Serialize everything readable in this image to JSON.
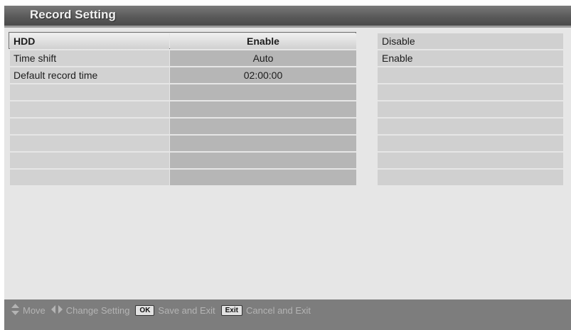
{
  "window": {
    "title": "Record Setting"
  },
  "settings": [
    {
      "label": "HDD",
      "value": "Enable"
    },
    {
      "label": "Time shift",
      "value": "Auto"
    },
    {
      "label": "Default record time",
      "value": "02:00:00"
    },
    {
      "label": "",
      "value": ""
    },
    {
      "label": "",
      "value": ""
    },
    {
      "label": "",
      "value": ""
    },
    {
      "label": "",
      "value": ""
    },
    {
      "label": "",
      "value": ""
    },
    {
      "label": "",
      "value": ""
    }
  ],
  "selected_row": "HDD",
  "options": [
    "Disable",
    "Enable",
    "",
    "",
    "",
    "",
    "",
    "",
    ""
  ],
  "help": {
    "move": "Move",
    "change": "Change Setting",
    "ok_key": "OK",
    "save": "Save and Exit",
    "exit_key": "Exit",
    "cancel": "Cancel and Exit"
  },
  "icons": {
    "move": "up-down-arrows-icon",
    "change": "left-right-arrows-icon"
  }
}
